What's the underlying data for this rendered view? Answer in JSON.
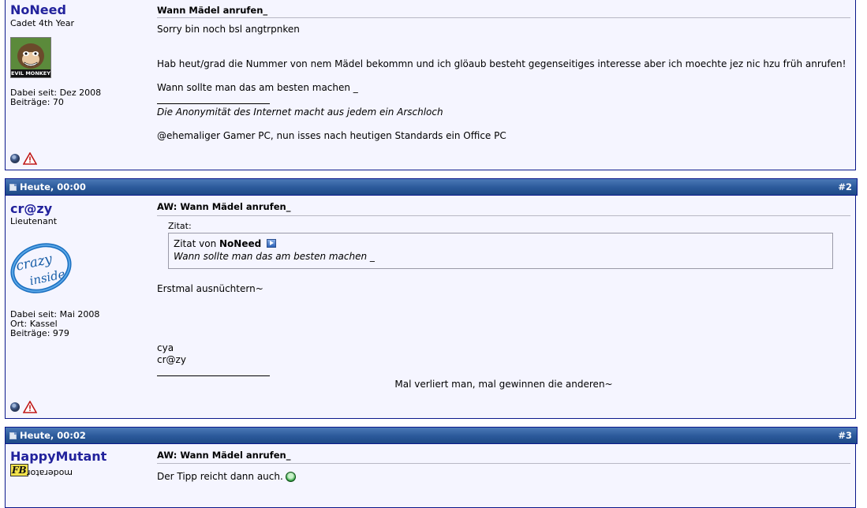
{
  "posts": [
    {
      "username": "NoNeed",
      "rank": "Cadet 4th Year",
      "avatar_label": "EVIL MONKEY",
      "joined": "Dabei seit: Dez 2008",
      "posts_count": "Beiträge: 70",
      "title": "Wann Mädel anrufen_",
      "lines": [
        "Sorry bin noch bsl angtrpnken",
        "Hab heut/grad die Nummer von nem Mädel bekommn und ich glöaub besteht gegenseitiges interesse aber ich moechte jez nic hzu früh anrufen!",
        "Wann sollte man das am besten machen _"
      ],
      "signature": [
        "Die Anonymität des Internet macht aus jedem ein Arschloch",
        "@ehemaliger Gamer PC, nun isses nach heutigen Standards ein Office PC"
      ]
    },
    {
      "date": "Heute, 00:00",
      "number": "#2",
      "username": "cr@zy",
      "rank": "Lieutenant",
      "avatar_text_1": "crazy",
      "avatar_text_2": "inside",
      "joined": "Dabei seit: Mai 2008",
      "location": "Ort: Kassel",
      "posts_count": "Beiträge: 979",
      "title": "AW: Wann Mädel anrufen_",
      "quote_label": "Zitat:",
      "quote_by_prefix": "Zitat von",
      "quote_author": "NoNeed",
      "quote_text": "Wann sollte man das am besten machen _",
      "lines": [
        "Erstmal ausnüchtern~",
        "cya",
        "cr@zy"
      ],
      "signature": "Mal verliert man, mal gewinnen die anderen~"
    },
    {
      "date": "Heute, 00:02",
      "number": "#3",
      "username": "HappyMutant",
      "rank": "moderator",
      "rank_badge": "FB",
      "title": "AW: Wann Mädel anrufen_",
      "lines": [
        "Der Tipp reicht dann auch."
      ]
    }
  ],
  "icons": {
    "status": "offline-status-icon",
    "report": "report-warning-icon",
    "post": "post-doc-icon",
    "view_post": "view-post-arrow-icon",
    "smiley": "grin-smiley-icon"
  },
  "colors": {
    "header_bar": "#2d5b9c",
    "post_bg": "#f5f5ff",
    "username": "#22229c",
    "border": "#0b198c"
  }
}
